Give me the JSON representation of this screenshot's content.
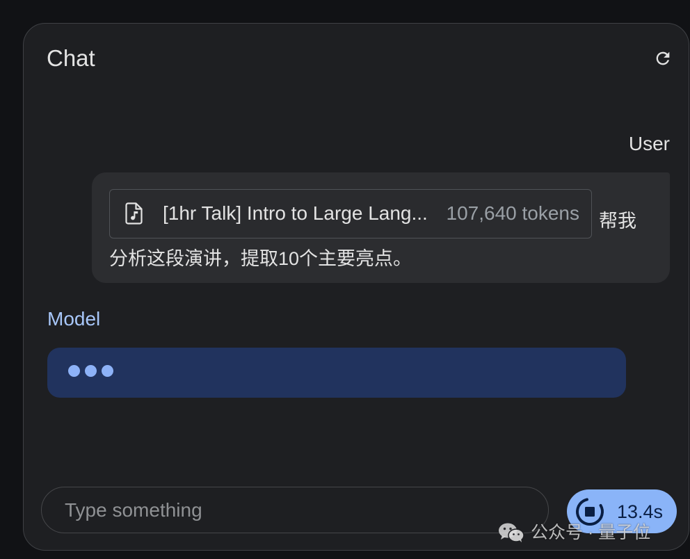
{
  "theme": {
    "page_bg": "#111215",
    "panel_bg": "#1e1f22",
    "user_bubble": "#2c2d30",
    "model_label": "#a8c7fa",
    "model_bubble": "#21335e",
    "typing_dot": "#8db2f7",
    "accent": "#8ab4f8",
    "on_accent": "#0a1f44",
    "text_primary": "#e3e3e3",
    "text_secondary": "#9aa0a6"
  },
  "header": {
    "title": "Chat",
    "refresh_icon": "refresh-icon"
  },
  "user_message": {
    "role_label": "User",
    "attachment": {
      "icon": "audio-file-icon",
      "file_name": "[1hr Talk] Intro to Large Lang...",
      "token_count": "107,640 tokens"
    },
    "text_lines": [
      "帮我",
      "分析这段演讲，提取10个主要亮点。"
    ]
  },
  "model_message": {
    "role_label": "Model",
    "typing_indicator_icon": "typing-dots-icon"
  },
  "composer": {
    "value": "",
    "placeholder": "Type something",
    "run_button": {
      "icon": "stop-icon",
      "elapsed": "13.4s"
    }
  },
  "watermark": {
    "icon": "wechat-icon",
    "text": "公众号 · 量子位"
  }
}
